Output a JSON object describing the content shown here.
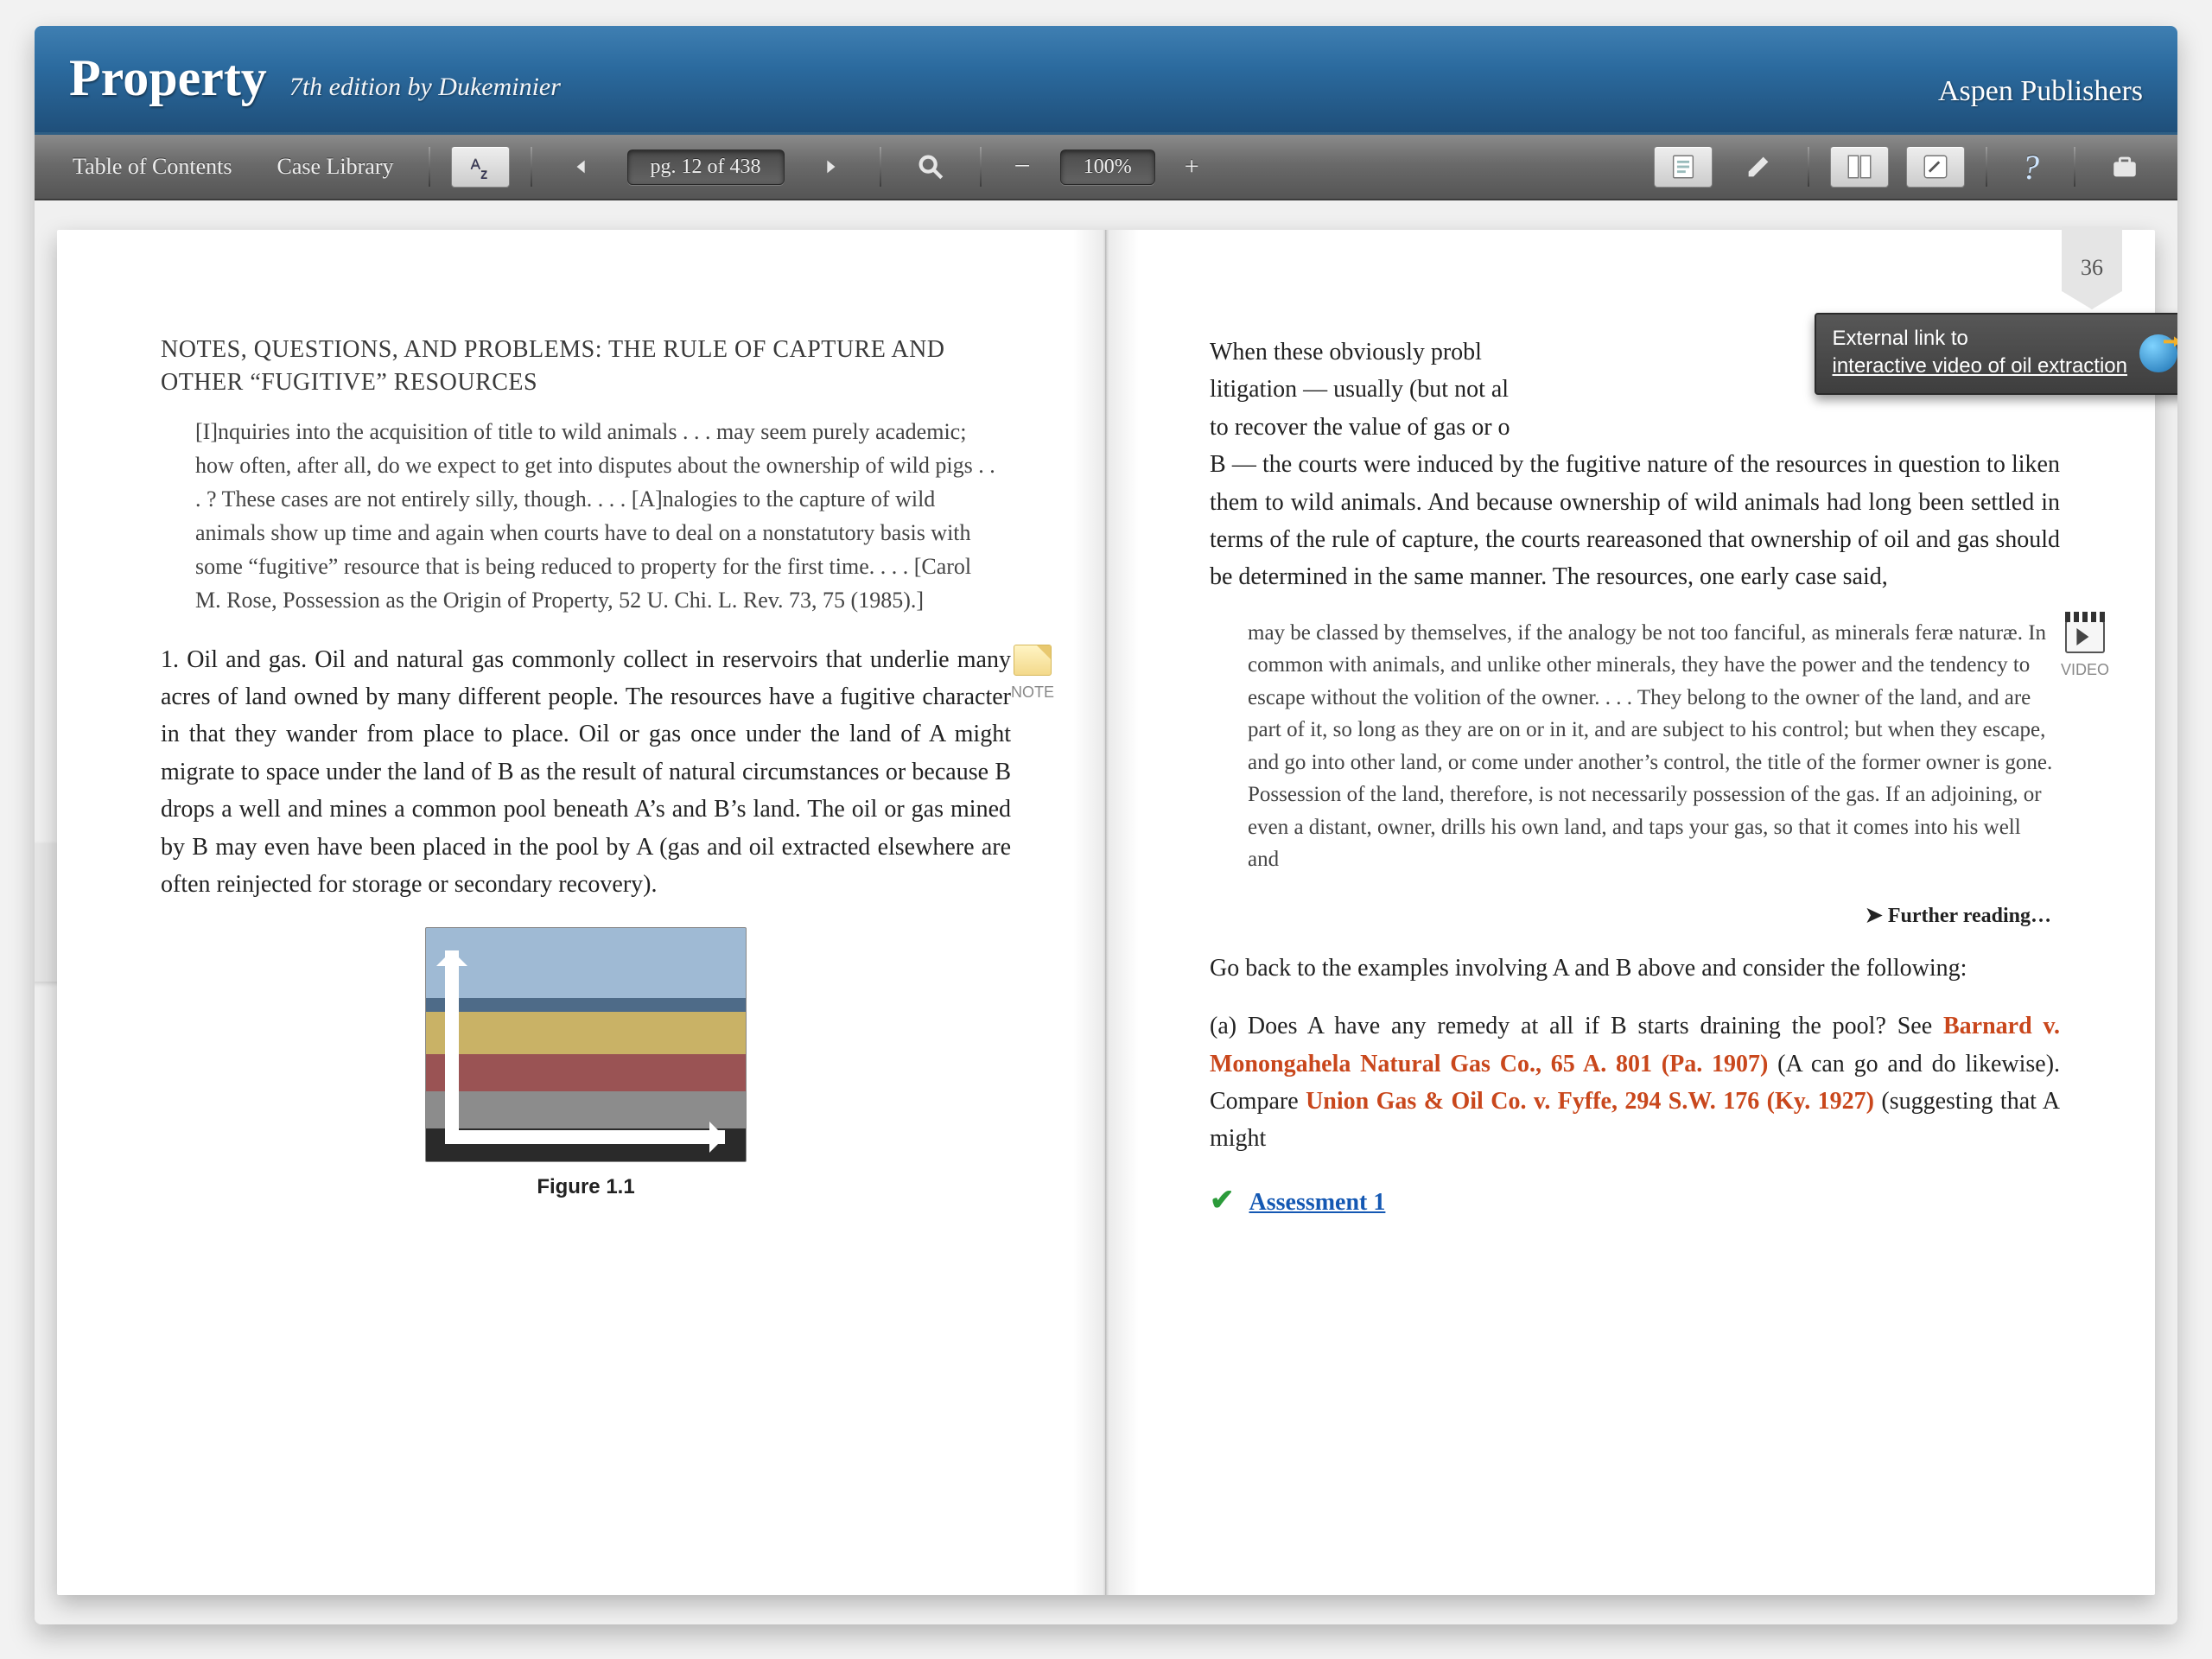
{
  "header": {
    "title": "Property",
    "subtitle": "7th edition by Dukeminier",
    "publisher": "Aspen Publishers"
  },
  "toolbar": {
    "toc": "Table of Contents",
    "case_library": "Case Library",
    "page_display": "pg. 12 of 438",
    "zoom": "100%"
  },
  "page_number": "36",
  "tooltip": {
    "line1": "External link to",
    "line2": "interactive video of oil extraction"
  },
  "left_page": {
    "heading": "NOTES, QUESTIONS, AND PROBLEMS: THE RULE OF CAPTURE AND OTHER “FUGITIVE” RESOURCES",
    "quote": "[I]nquiries into the acquisition of title to wild animals . . . may seem purely academic; how often, after all, do we expect to get into disputes about the ownership of wild pigs . . . ? These cases are not entirely silly, though. . . . [A]nalogies to the capture of wild animals show up time and again when courts have to deal on a nonstatutory basis with some “fugitive” resource that is being reduced to property for the first time. . . . [Carol M. Rose, Possession as the Origin of Property, 52 U. Chi. L. Rev. 73, 75 (1985).]",
    "body1": "1. Oil and gas. Oil and natural gas commonly collect in reservoirs that underlie many acres of land owned by many different people. The resources have a fugitive character in that they wander from place to place. Oil or gas once under the land of A might migrate to space under the land of B as the result of natural circumstances or because B drops a well and mines a common pool beneath A’s and B’s land. The oil or gas mined by B may even have been placed in the pool by A (gas and oil extracted elsewhere are often reinjected for storage or secondary recovery).",
    "figure_caption": "Figure 1.1",
    "note_label": "NOTE"
  },
  "right_page": {
    "body1a": "When these obviously probl",
    "body1b": "litigation — usually (but not al",
    "body1c": "to recover the value of gas or o",
    "body1d": "B — the courts were induced by the fugitive nature of the resources in question to liken them to wild animals. And because ownership of wild animals had long been settled in terms of the rule of capture, the courts reareasoned that ownership of oil and gas should be determined in the same manner. The resources, one early case said,",
    "quote": "may be classed by themselves, if the analogy be not too fanciful, as minerals feræ naturæ. In common with animals, and unlike other minerals, they have the power and the tendency to escape without the volition of the owner. . . . They belong to the owner of the land, and are part of it, so long as they are on or in it, and are subject to his control; but when they escape, and go into other land, or come under another’s control, the title of the former owner is gone. Possession of the land, therefore, is not necessarily possession of the gas. If an adjoining, or even a distant, owner, drills his own land, and taps your gas, so that it comes into his well and",
    "further": "Further reading…",
    "body2": "Go back to the examples involving A and B above and consider the following:",
    "body3a": "(a) Does A have any remedy at all if B starts draining the pool? See ",
    "case1": "Barnard v. Monongahela Natural Gas Co., 65 A. 801 (Pa. 1907)",
    "body3b": " (A can go and do likewise). Compare ",
    "case2": "Union Gas & Oil Co. v. Fyffe, 294 S.W. 176 (Ky. 1927)",
    "body3c": " (suggesting that A might",
    "assessment": "Assessment 1",
    "video_label": "VIDEO"
  }
}
